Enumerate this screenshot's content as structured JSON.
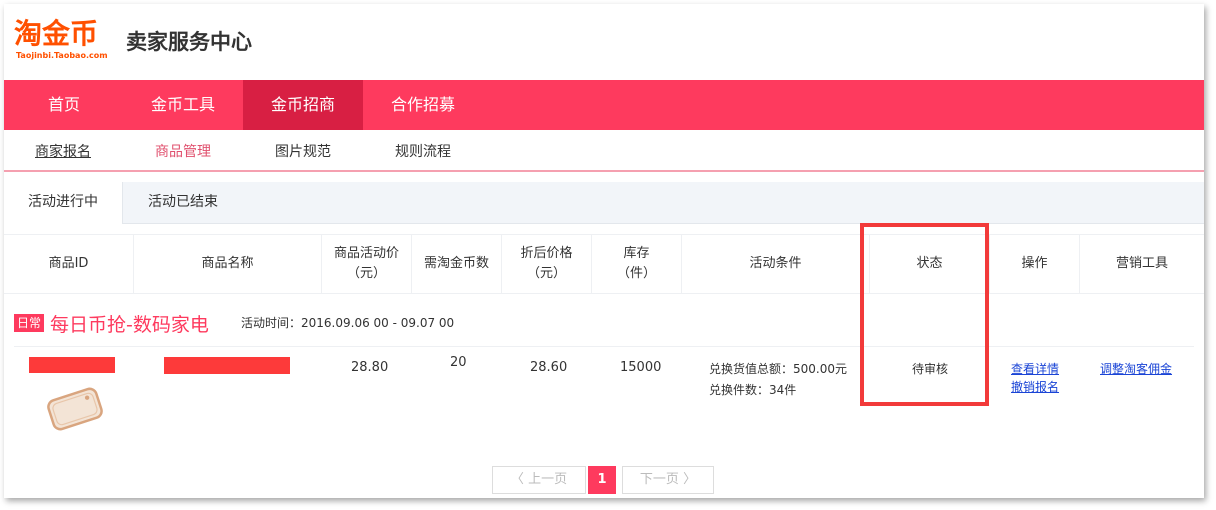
{
  "brand": {
    "logo_main": "淘金币",
    "logo_sub": "Taojinbi.Taobao.com",
    "site_title": "卖家服务中心",
    "logo_color": "#ff5000"
  },
  "main_nav": [
    "首页",
    "金币工具",
    "金币招商",
    "合作招募"
  ],
  "main_nav_active": "金币招商",
  "sub_nav": [
    "商家报名",
    "商品管理",
    "图片规范",
    "规则流程"
  ],
  "tabs": [
    "活动进行中",
    "活动已结束"
  ],
  "table": {
    "headers": {
      "id": "商品ID",
      "name": "商品名称",
      "price_line1": "商品活动价",
      "price_line2": "（元）",
      "coins": "需淘金币数",
      "discount_line1": "折后价格",
      "discount_line2": "（元）",
      "stock_line1": "库存",
      "stock_line2": "（件）",
      "conditions": "活动条件",
      "status": "状态",
      "actions": "操作",
      "tools": "营销工具"
    },
    "group": {
      "badge": "日常",
      "title": "每日币抢-数码家电",
      "time": "活动时间：2016.09.06 00 - 09.07 00"
    },
    "row": {
      "activity_price": "28.80",
      "coins": "20",
      "discount_price": "28.60",
      "stock": "15000",
      "condition_1": "兑换货值总额：500.00元",
      "condition_2": "兑换件数：34件",
      "status": "待审核",
      "action_1": "查看详情",
      "action_2": "撤销报名",
      "tool": "调整淘客佣金"
    }
  },
  "pager": {
    "prev": "上一页",
    "current": "1",
    "next": "下一页"
  },
  "colors": {
    "nav_bg": "#fe3a5e",
    "nav_active": "#d81f43",
    "highlight_box": "#f23a3a",
    "link": "#1a44d6"
  }
}
